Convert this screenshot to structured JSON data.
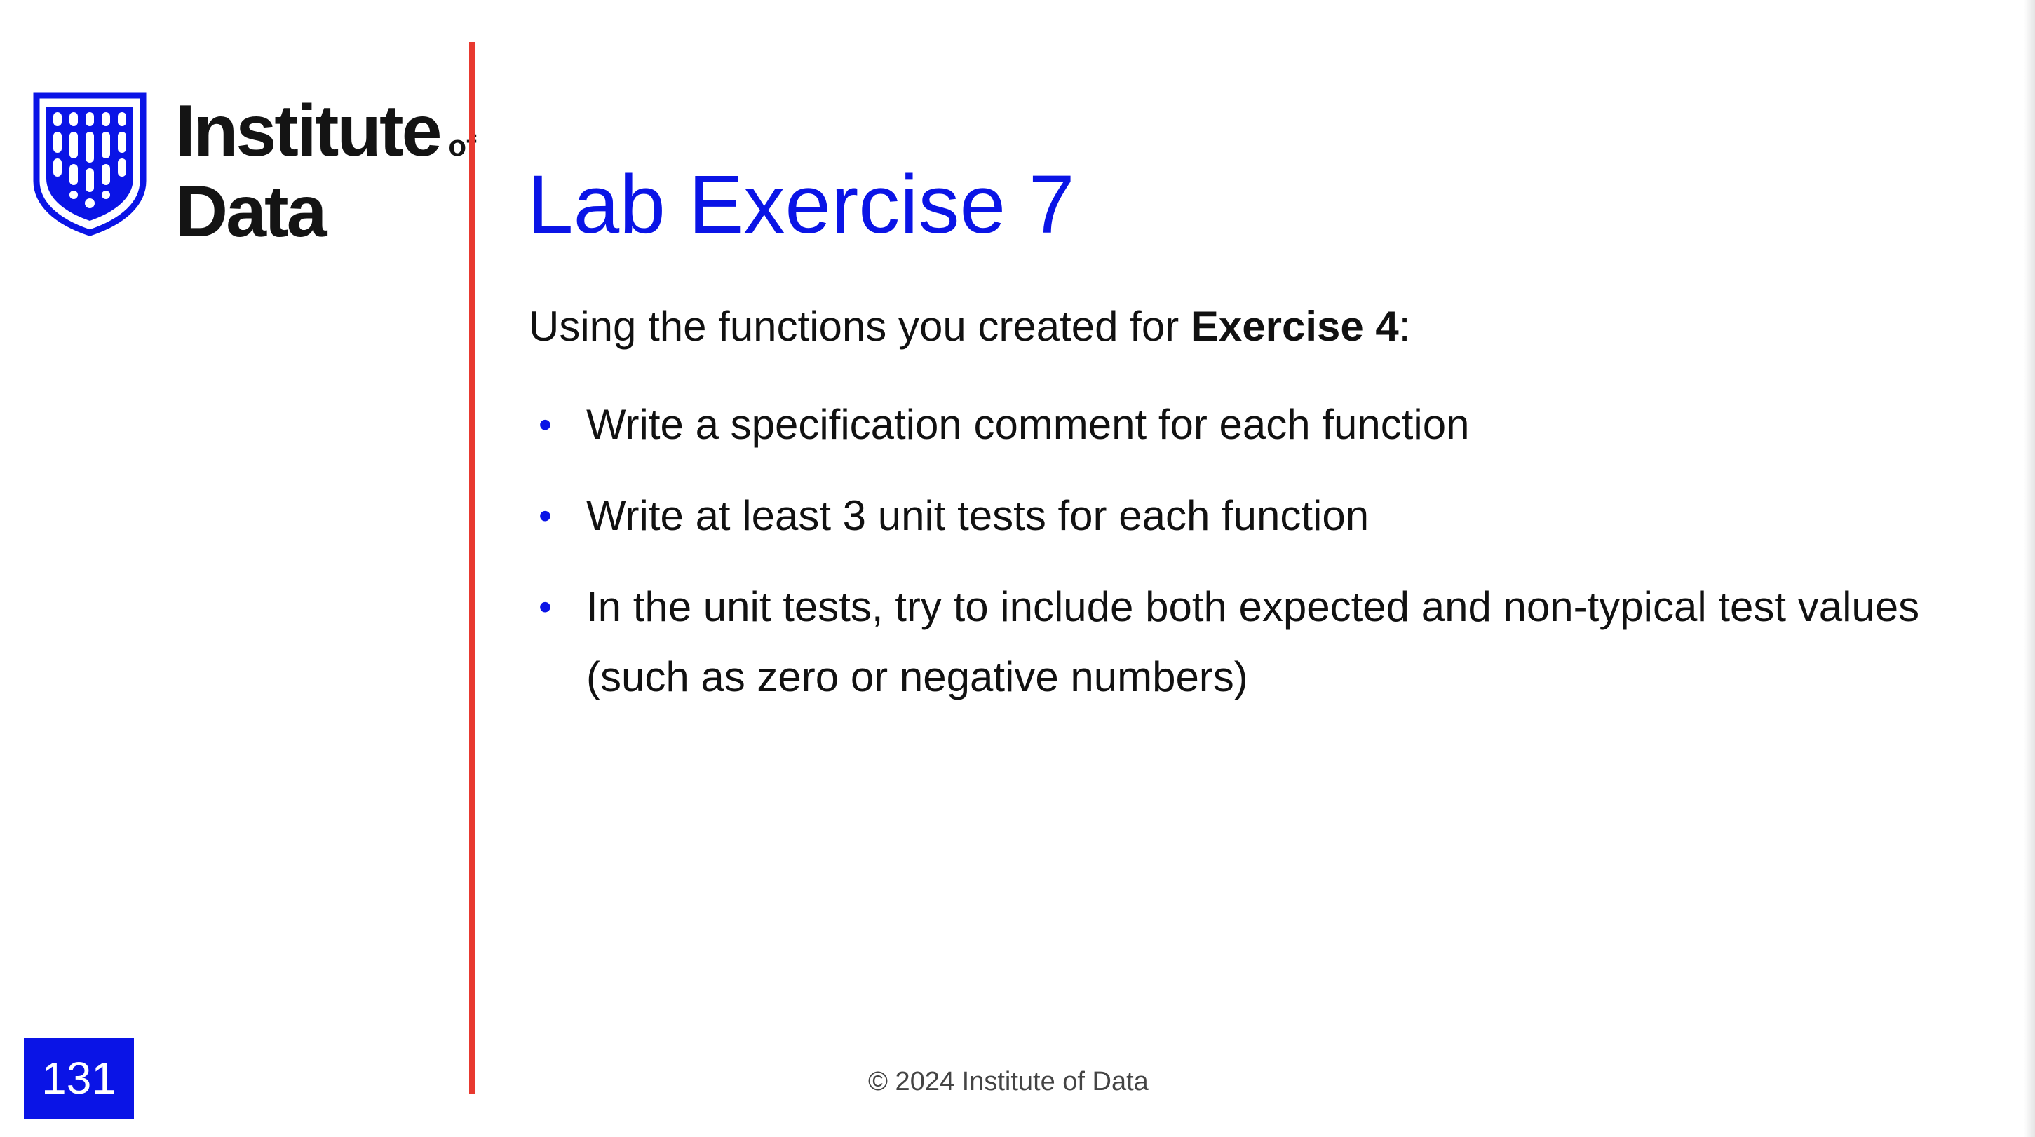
{
  "logo": {
    "name_line1": "Institute",
    "name_of": "of",
    "name_line2": "Data"
  },
  "slide": {
    "title": "Lab Exercise 7",
    "intro_prefix": "Using the functions you created for ",
    "intro_bold": "Exercise 4",
    "intro_suffix": ":",
    "bullets": [
      "Write a specification comment for each function",
      "Write at least 3 unit tests for each function",
      "In the unit tests, try to include both expected and non-typical test values (such as zero or negative numbers)"
    ],
    "bullet_symbol": "•",
    "number": "131"
  },
  "footer": {
    "copyright": "© 2024 Institute of Data"
  },
  "colors": {
    "accent_blue": "#0a14e6",
    "divider_red": "#e8392f"
  }
}
